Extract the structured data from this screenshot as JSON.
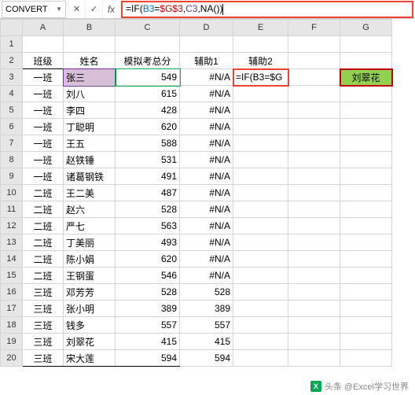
{
  "formula_bar": {
    "name_box": "CONVERT",
    "formula_display": "=IF(B3=$G$3,C3,NA())",
    "eq": "=",
    "fn": "IF",
    "open": "(",
    "arg1a": "B3",
    "arg1b": "=",
    "arg1c": "$G$3",
    "c1": ",",
    "arg2": "C3",
    "c2": ",",
    "arg3fn": "NA",
    "arg3p": "()",
    "close": ")"
  },
  "col_headers": [
    "A",
    "B",
    "C",
    "D",
    "E",
    "F",
    "G"
  ],
  "headers": {
    "A": "班级",
    "B": "姓名",
    "C": "模拟考总分",
    "D": "辅助1",
    "E": "辅助2"
  },
  "editing_cell": "=IF(B3=$G",
  "g3": "刘翠花",
  "rows": [
    {
      "r": 3,
      "A": "一班",
      "B": "张三",
      "C": "549",
      "D": "#N/A"
    },
    {
      "r": 4,
      "A": "一班",
      "B": "刘八",
      "C": "615",
      "D": "#N/A"
    },
    {
      "r": 5,
      "A": "一班",
      "B": "李四",
      "C": "428",
      "D": "#N/A"
    },
    {
      "r": 6,
      "A": "一班",
      "B": "丁聪明",
      "C": "620",
      "D": "#N/A"
    },
    {
      "r": 7,
      "A": "一班",
      "B": "王五",
      "C": "588",
      "D": "#N/A"
    },
    {
      "r": 8,
      "A": "一班",
      "B": "赵铁锤",
      "C": "531",
      "D": "#N/A"
    },
    {
      "r": 9,
      "A": "一班",
      "B": "诸葛钢铁",
      "C": "491",
      "D": "#N/A"
    },
    {
      "r": 10,
      "A": "二班",
      "B": "王二美",
      "C": "487",
      "D": "#N/A"
    },
    {
      "r": 11,
      "A": "二班",
      "B": "赵六",
      "C": "528",
      "D": "#N/A"
    },
    {
      "r": 12,
      "A": "二班",
      "B": "严七",
      "C": "563",
      "D": "#N/A"
    },
    {
      "r": 13,
      "A": "二班",
      "B": "丁美丽",
      "C": "493",
      "D": "#N/A"
    },
    {
      "r": 14,
      "A": "二班",
      "B": "陈小娟",
      "C": "620",
      "D": "#N/A"
    },
    {
      "r": 15,
      "A": "二班",
      "B": "王钢蛋",
      "C": "546",
      "D": "#N/A"
    },
    {
      "r": 16,
      "A": "三班",
      "B": "邓芳芳",
      "C": "528",
      "D": "528"
    },
    {
      "r": 17,
      "A": "三班",
      "B": "张小明",
      "C": "389",
      "D": "389"
    },
    {
      "r": 18,
      "A": "三班",
      "B": "钱多",
      "C": "557",
      "D": "557"
    },
    {
      "r": 19,
      "A": "三班",
      "B": "刘翠花",
      "C": "415",
      "D": "415"
    },
    {
      "r": 20,
      "A": "三班",
      "B": "宋大莲",
      "C": "594",
      "D": "594"
    }
  ],
  "footer": "头条 @Excel学习世界"
}
